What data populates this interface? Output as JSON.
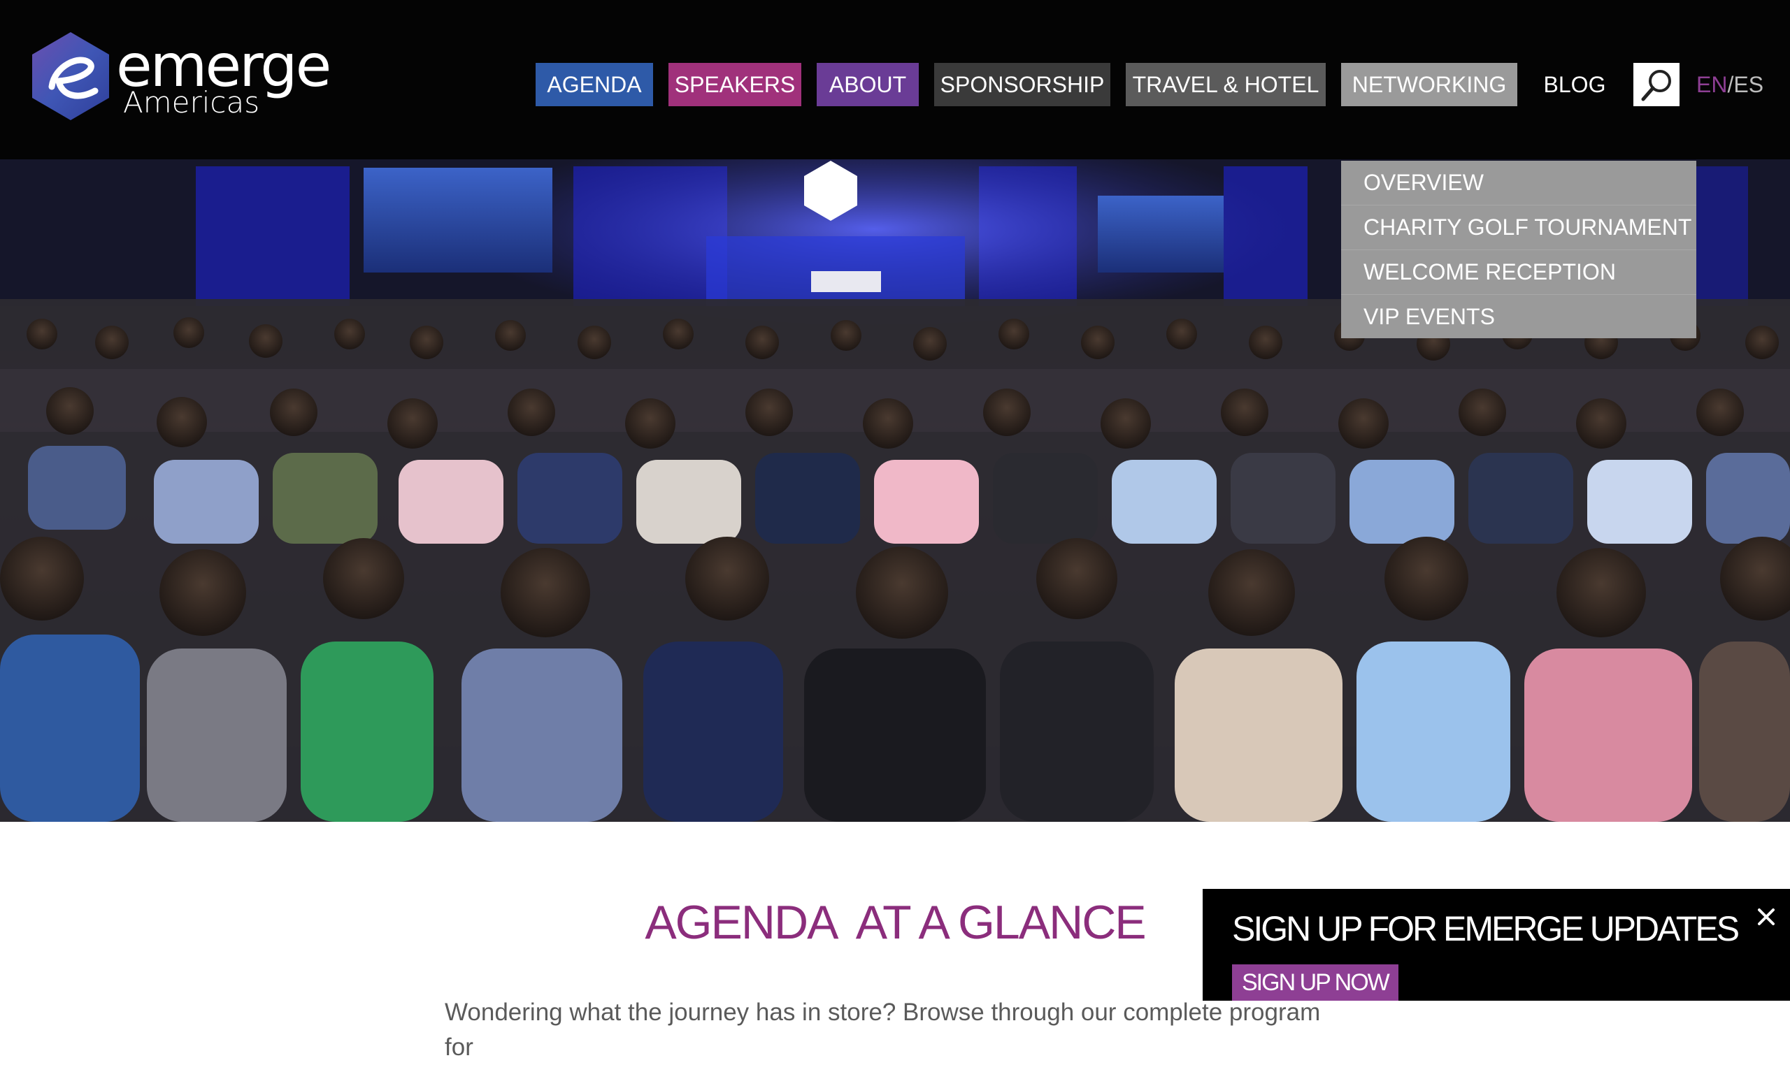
{
  "logo": {
    "main": "emerge",
    "sub": "Americas"
  },
  "nav": [
    {
      "label": "AGENDA",
      "color": "#2e5aa8"
    },
    {
      "label": "SPEAKERS",
      "color": "#a0317b"
    },
    {
      "label": "ABOUT",
      "color": "#6a3c96"
    },
    {
      "label": "SPONSORSHIP",
      "color": "#3a3a3a"
    },
    {
      "label": "TRAVEL & HOTEL",
      "color": "#5b5b5b"
    },
    {
      "label": "NETWORKING",
      "color": "#9a9a9a"
    },
    {
      "label": "BLOG",
      "color": "transparent"
    }
  ],
  "search": {
    "icon": "search-icon"
  },
  "language": {
    "en": "EN",
    "separator": "/",
    "es": "ES",
    "active": "EN",
    "active_color": "#8e3f94"
  },
  "dropdown": {
    "items": [
      "OVERVIEW",
      "CHARITY GOLF TOURNAMENT",
      "WELCOME RECEPTION",
      "VIP EVENTS"
    ]
  },
  "hero": {
    "image": "conference-audience-photo"
  },
  "content": {
    "title": "AGENDA  AT A GLANCE",
    "intro": "Wondering what the journey has in store? Browse through our complete program for"
  },
  "signup": {
    "title": "SIGN UP FOR EMERGE UPDATES",
    "button": "SIGN UP NOW",
    "close_icon": "close-icon"
  },
  "colors": {
    "brand_purple": "#8e3f94",
    "title_purple": "#8b2d7c",
    "header_bg": "#040404"
  }
}
